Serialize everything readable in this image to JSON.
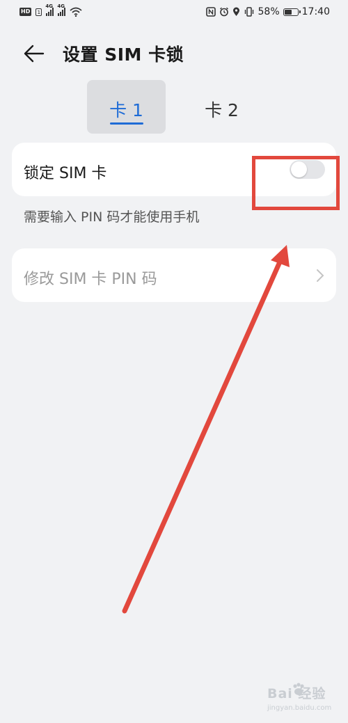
{
  "status_bar": {
    "hd_badge": "HD",
    "sim_badge": "1",
    "net1": "4G",
    "net2": "4G",
    "battery_text": "58%",
    "time": "17:40",
    "battery_level": 0.58
  },
  "header": {
    "title": "设置 SIM 卡锁",
    "back_icon": "arrow-left-icon"
  },
  "tabs": [
    {
      "label": "卡 1",
      "active": true
    },
    {
      "label": "卡 2",
      "active": false
    }
  ],
  "settings": {
    "lock_sim": {
      "label": "锁定 SIM 卡",
      "enabled": false
    },
    "hint": "需要输入 PIN 码才能使用手机",
    "change_pin": {
      "label": "修改 SIM 卡 PIN 码",
      "disabled": true
    }
  },
  "colors": {
    "accent": "#1e6bd6",
    "annotation": "#e2483d",
    "background": "#f1f2f4"
  },
  "watermark": {
    "brand": "Bai  经验",
    "url": "jingyan.baidu.com"
  }
}
